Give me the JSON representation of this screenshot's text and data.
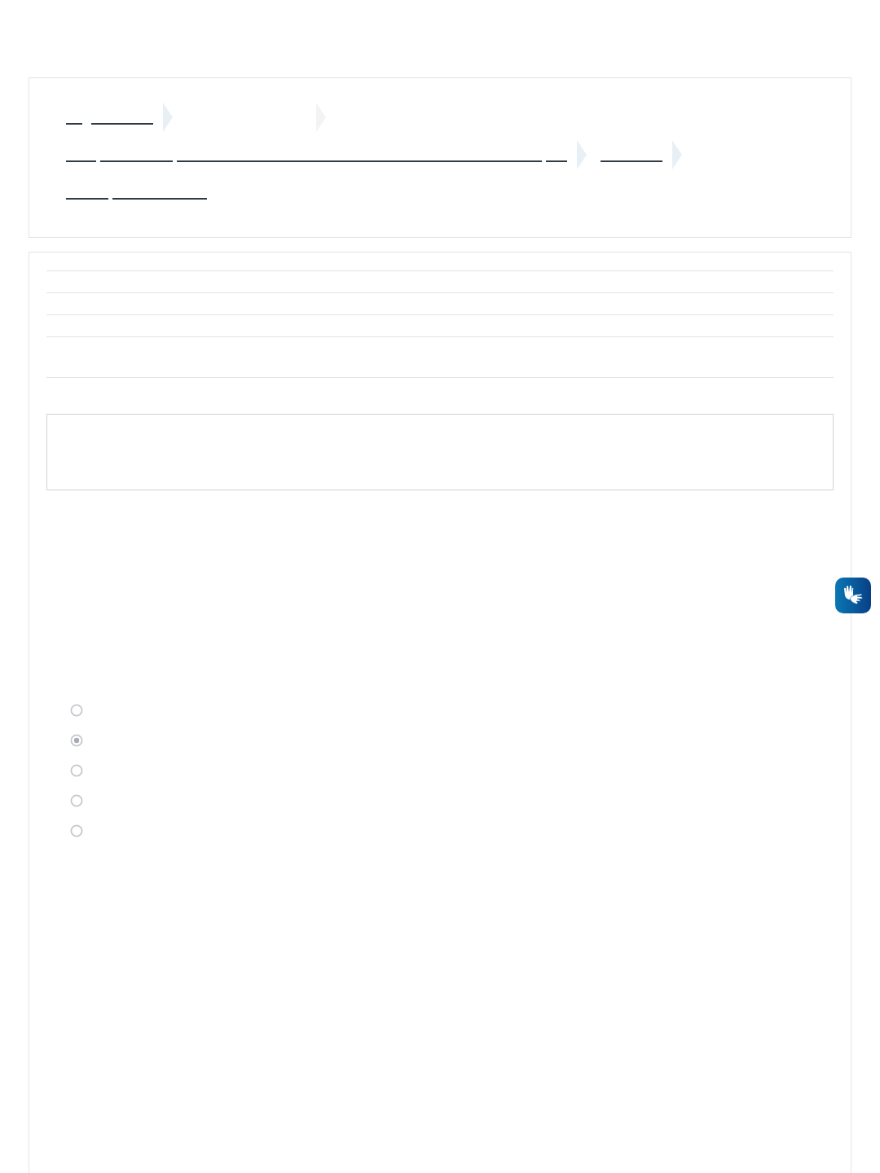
{
  "options": [
    {
      "selected": false
    },
    {
      "selected": true
    },
    {
      "selected": false
    },
    {
      "selected": false
    },
    {
      "selected": false
    }
  ]
}
